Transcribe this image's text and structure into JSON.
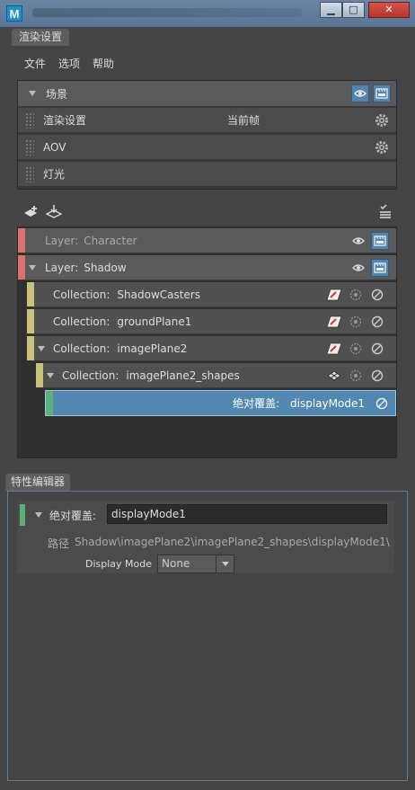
{
  "app": {
    "icon_letter": "M"
  },
  "window": {
    "min": "▁",
    "max": "□",
    "close": "✕"
  },
  "tabs": {
    "render_setup": "渲染设置",
    "property_editor": "特性编辑器"
  },
  "menu": [
    "文件",
    "选项",
    "帮助"
  ],
  "scene": {
    "label": "场景",
    "rows": [
      {
        "label": "渲染设置",
        "value": "当前帧"
      },
      {
        "label": "AOV"
      },
      {
        "label": "灯光"
      }
    ]
  },
  "layers": [
    {
      "prefix": "Layer:",
      "name": "Character",
      "color": "#d9716c"
    },
    {
      "prefix": "Layer:",
      "name": "Shadow",
      "color": "#d9716c"
    }
  ],
  "collections": [
    {
      "prefix": "Collection:",
      "name": "ShadowCasters",
      "color": "#c9c37a"
    },
    {
      "prefix": "Collection:",
      "name": "groundPlane1",
      "color": "#c9c37a"
    },
    {
      "prefix": "Collection:",
      "name": "imagePlane2",
      "color": "#c9c37a"
    },
    {
      "prefix": "Collection:",
      "name": "imagePlane2_shapes",
      "color": "#c9c37a"
    }
  ],
  "override": {
    "prefix": "绝对覆盖:",
    "name": "displayMode1",
    "color": "#5eb079"
  },
  "property_editor": {
    "override_label": "绝对覆盖:",
    "override_value": "displayMode1",
    "path_label": "路径",
    "path_value": "Shadow\\imagePlane2\\imagePlane2_shapes\\displayMode1\\",
    "display_mode_label": "Display Mode",
    "display_mode_value": "None"
  }
}
